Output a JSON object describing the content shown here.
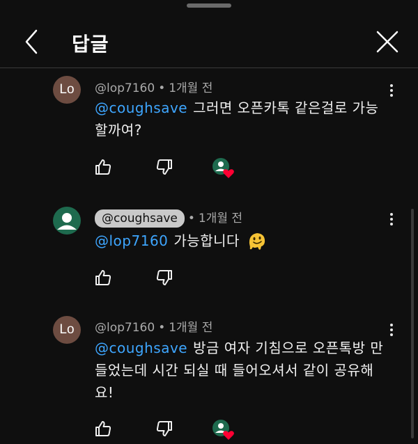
{
  "header": {
    "title": "답글",
    "back_icon": "chevron-left-icon",
    "close_icon": "close-icon"
  },
  "comments": [
    {
      "avatar_initials": "Lo",
      "author": "@lop7160",
      "separator": "•",
      "time": "1개월 전",
      "mention": "@coughsave",
      "text": "그러면 오픈카톡 같은걸로 가능할까여?",
      "hearted": true
    },
    {
      "avatar_icon": "user-icon",
      "author": "@coughsave",
      "is_owner": true,
      "separator": "•",
      "time": "1개월 전",
      "mention": "@lop7160",
      "text": "가능합니다",
      "emoji": "🫠",
      "hearted": false
    },
    {
      "avatar_initials": "Lo",
      "author": "@lop7160",
      "separator": "•",
      "time": "1개월 전",
      "mention": "@coughsave",
      "text": "방금 여자 기침으로 오픈톡방 만들었는데 시간 되실 때 들어오셔서 같이 공유해요!",
      "hearted": true
    }
  ],
  "colors": {
    "background": "#0f0f0f",
    "mention": "#3ea6ff",
    "heart": "#ff0033",
    "owner_chip": "#c9c9c9"
  }
}
